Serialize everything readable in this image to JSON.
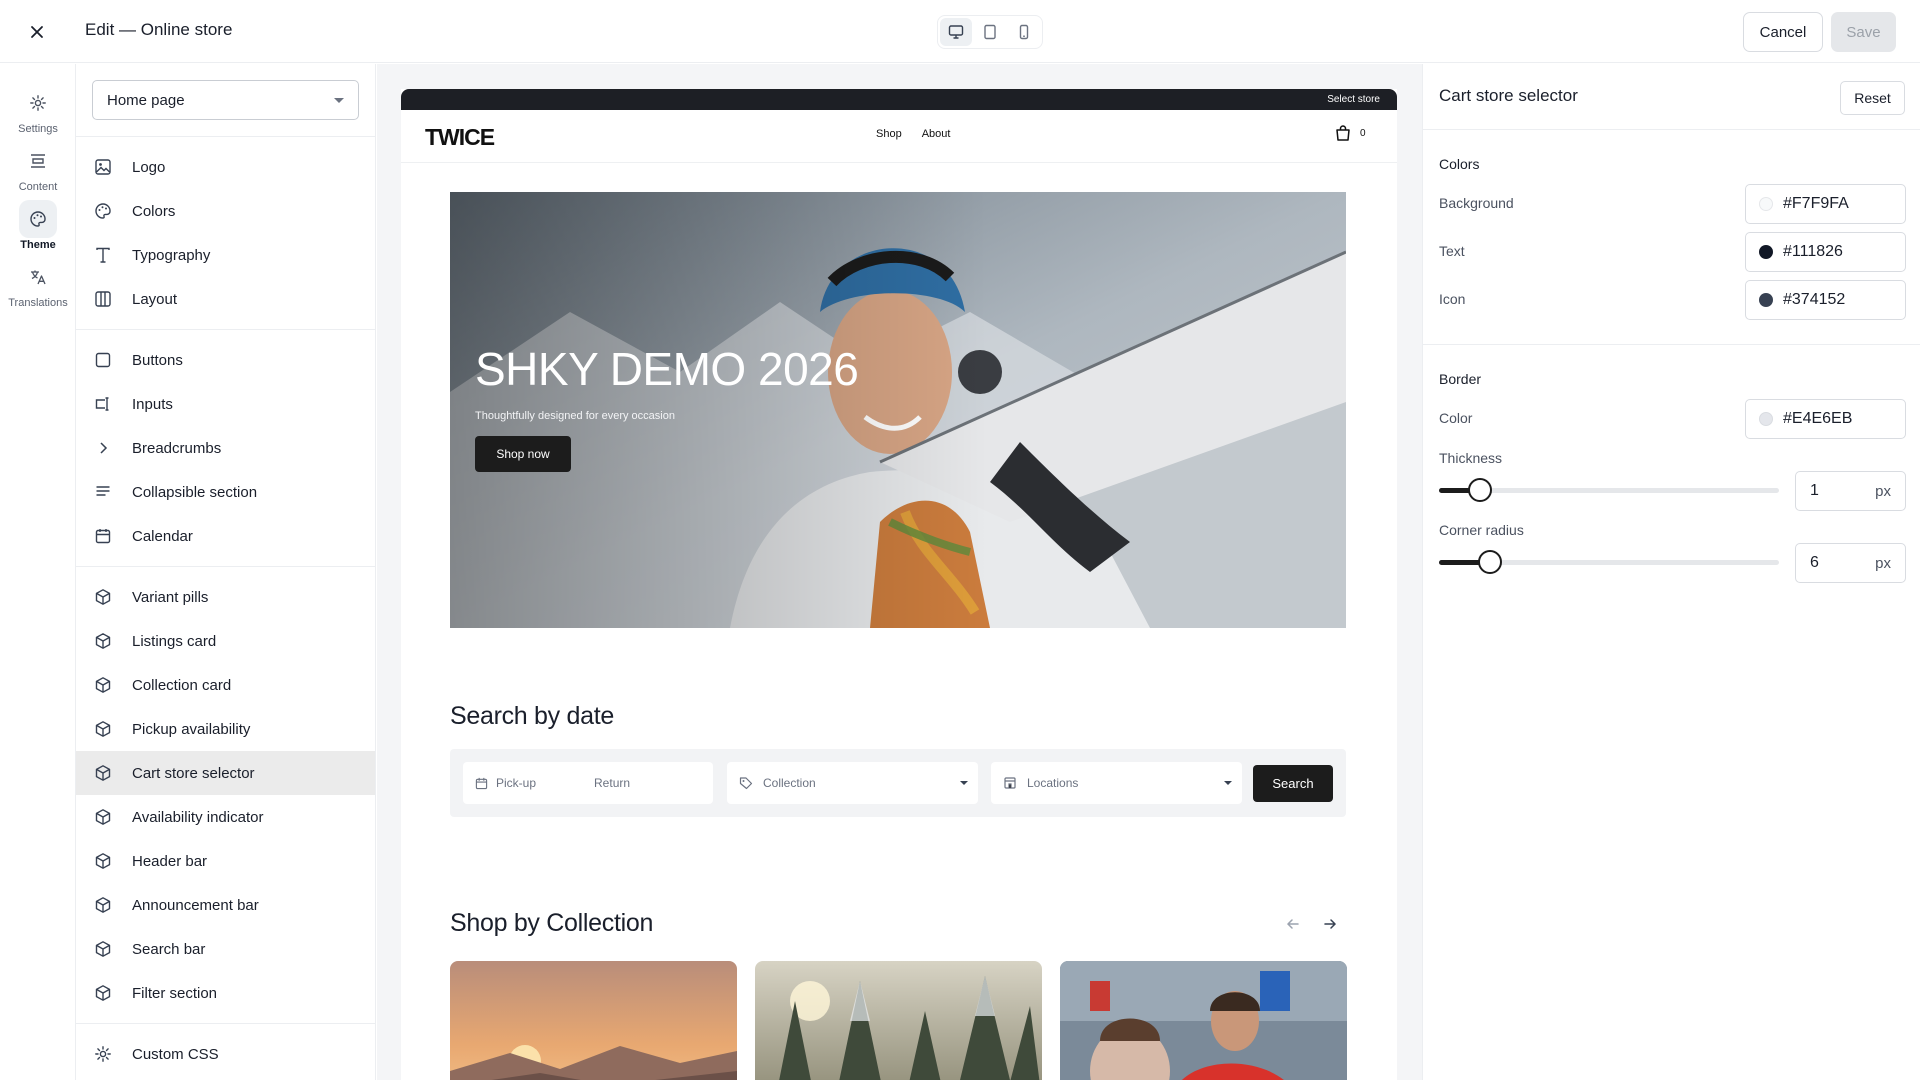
{
  "topbar": {
    "title": "Edit — Online store",
    "cancel_label": "Cancel",
    "save_label": "Save"
  },
  "rail": {
    "items": [
      {
        "label": "Settings",
        "icon": "gear-icon"
      },
      {
        "label": "Content",
        "icon": "content-icon"
      },
      {
        "label": "Theme",
        "icon": "palette-icon",
        "active": true
      },
      {
        "label": "Translations",
        "icon": "translate-icon"
      }
    ]
  },
  "sidebar": {
    "page_select": "Home page",
    "items": [
      {
        "label": "Logo",
        "icon": "image-icon"
      },
      {
        "label": "Colors",
        "icon": "palette-icon"
      },
      {
        "label": "Typography",
        "icon": "type-icon"
      },
      {
        "label": "Layout",
        "icon": "columns-icon"
      },
      {
        "label": "Buttons",
        "icon": "square-icon"
      },
      {
        "label": "Inputs",
        "icon": "input-icon"
      },
      {
        "label": "Breadcrumbs",
        "icon": "chevron-right-icon"
      },
      {
        "label": "Collapsible section",
        "icon": "lines-icon"
      },
      {
        "label": "Calendar",
        "icon": "calendar-icon"
      },
      {
        "label": "Variant pills",
        "icon": "cube-icon"
      },
      {
        "label": "Listings card",
        "icon": "cube-icon"
      },
      {
        "label": "Collection card",
        "icon": "cube-icon"
      },
      {
        "label": "Pickup availability",
        "icon": "cube-icon"
      },
      {
        "label": "Cart store selector",
        "icon": "cube-icon",
        "active": true
      },
      {
        "label": "Availability indicator",
        "icon": "cube-icon"
      },
      {
        "label": "Header bar",
        "icon": "cube-icon"
      },
      {
        "label": "Announcement bar",
        "icon": "cube-icon"
      },
      {
        "label": "Search bar",
        "icon": "cube-icon"
      },
      {
        "label": "Filter section",
        "icon": "cube-icon"
      },
      {
        "label": "Custom CSS",
        "icon": "gear-icon"
      }
    ]
  },
  "preview": {
    "announcement": "Select store",
    "logo": "TWICE",
    "nav": [
      "Shop",
      "About"
    ],
    "cart_count": "0",
    "hero": {
      "title": "SHKY DEMO 2026",
      "subtitle": "Thoughtfully designed for every occasion",
      "button": "Shop now"
    },
    "search": {
      "title": "Search by date",
      "pickup": "Pick-up",
      "return": "Return",
      "collection": "Collection",
      "locations": "Locations",
      "button": "Search"
    },
    "collections": {
      "title": "Shop by Collection"
    }
  },
  "panel": {
    "title": "Cart store selector",
    "reset_label": "Reset",
    "colors_heading": "Colors",
    "colors": [
      {
        "label": "Background",
        "value": "#F7F9FA"
      },
      {
        "label": "Text",
        "value": "#111826"
      },
      {
        "label": "Icon",
        "value": "#374152"
      }
    ],
    "border_heading": "Border",
    "border_color_label": "Color",
    "border_color_value": "#E4E6EB",
    "thickness_label": "Thickness",
    "thickness_value": "1",
    "thickness_fraction": 0.12,
    "radius_label": "Corner radius",
    "radius_value": "6",
    "radius_fraction": 0.15,
    "unit": "px"
  }
}
